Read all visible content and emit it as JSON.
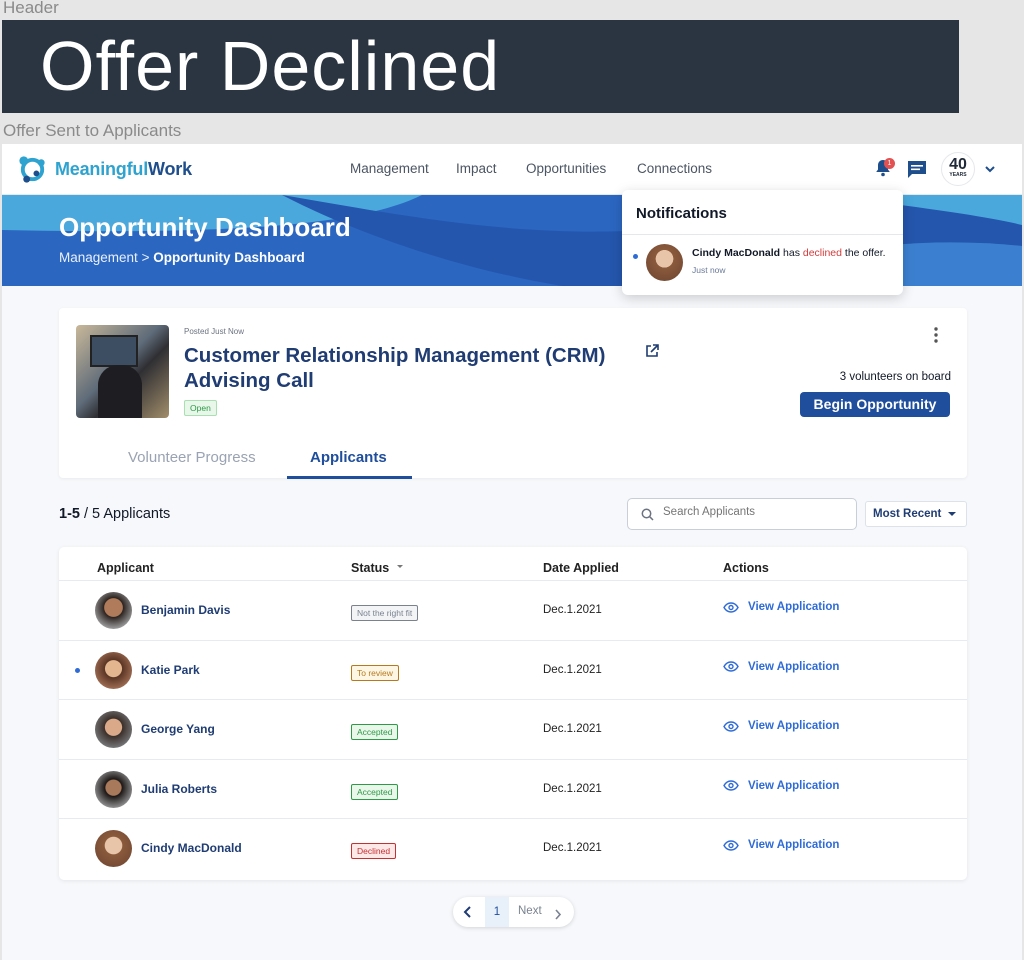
{
  "frame": {
    "header_label": "Header",
    "banner_text": "Offer Declined",
    "section_label": "Offer Sent to Applicants"
  },
  "brand": {
    "name_part1": "Meaningful",
    "name_part2": "Work",
    "color_primary": "#2ea3cf",
    "color_dark": "#1f4e8c"
  },
  "nav": {
    "links": [
      "Management",
      "Impact",
      "Opportunities",
      "Connections"
    ],
    "bell_count": "1",
    "avatar_number": "40",
    "avatar_caption": "YEARS"
  },
  "banner": {
    "title": "Opportunity Dashboard",
    "breadcrumb_root": "Management",
    "breadcrumb_sep": ">",
    "breadcrumb_current": "Opportunity Dashboard"
  },
  "notifications": {
    "title": "Notifications",
    "item": {
      "name": "Cindy MacDonald",
      "text_mid": " has ",
      "action": "declined",
      "text_end": " the offer.",
      "time": "Just now"
    }
  },
  "opportunity": {
    "posted": "Posted Just Now",
    "title": "Customer Relationship Management (CRM) Advising Call",
    "status": "Open",
    "volunteers": "3 volunteers on board",
    "begin_label": "Begin Opportunity",
    "tabs": [
      "Volunteer Progress",
      "Applicants"
    ]
  },
  "applicants": {
    "count_range": "1-5",
    "count_total": " / 5 Applicants",
    "search_placeholder": "Search Applicants",
    "sort_label": "Most Recent",
    "columns": [
      "Applicant",
      "Status",
      "Date Applied",
      "Actions"
    ],
    "view_label": "View Application",
    "rows": [
      {
        "name": "Benjamin Davis",
        "status": "Not the right fit",
        "status_style": "gray",
        "date": "Dec.1.2021",
        "unread": false
      },
      {
        "name": "Katie Park",
        "status": "To review",
        "status_style": "yellow",
        "date": "Dec.1.2021",
        "unread": true
      },
      {
        "name": "George Yang",
        "status": "Accepted",
        "status_style": "green",
        "date": "Dec.1.2021",
        "unread": false
      },
      {
        "name": "Julia Roberts",
        "status": "Accepted",
        "status_style": "green",
        "date": "Dec.1.2021",
        "unread": false
      },
      {
        "name": "Cindy MacDonald",
        "status": "Declined",
        "status_style": "red",
        "date": "Dec.1.2021",
        "unread": false
      }
    ]
  },
  "pagination": {
    "current_page": "1",
    "next_label": "Next"
  }
}
